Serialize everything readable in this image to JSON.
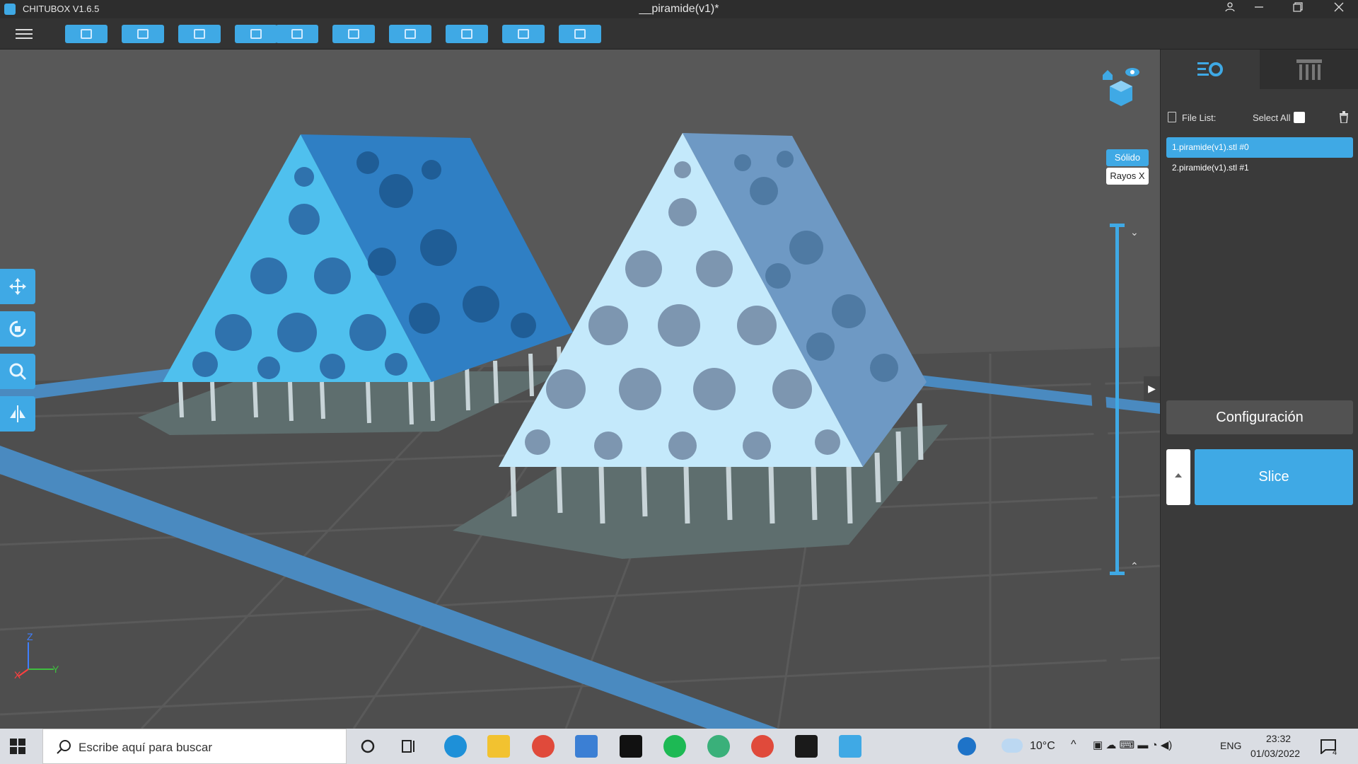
{
  "window": {
    "app_name": "CHITUBOX V1.6.5",
    "document_title": "__piramide(v1)*"
  },
  "colors": {
    "accent": "#3fa9e5",
    "viewport_bg": "#585858",
    "panel_bg": "#3a3a3a",
    "model_primary": "#4aa9e8",
    "model_highlight": "#9ad8f5",
    "support": "#c8d4d8",
    "raft": "#5e6e6e",
    "plate_border": "#4a8ac0"
  },
  "toolbar": {
    "buttons": [
      {
        "name": "open-file-button",
        "icon": "folder-icon"
      },
      {
        "name": "save-button",
        "icon": "floppy-icon"
      },
      {
        "name": "screenshot-button",
        "icon": "frame-icon"
      },
      {
        "name": "undo-button",
        "icon": "undo-icon"
      },
      {
        "name": "redo-button",
        "icon": "redo-icon"
      },
      {
        "name": "document-button",
        "icon": "document-icon"
      },
      {
        "name": "arrange-button",
        "icon": "layout-icon"
      },
      {
        "name": "hollow-button",
        "icon": "bottle-icon"
      },
      {
        "name": "print-preview-button",
        "icon": "square-icon"
      },
      {
        "name": "export-button",
        "icon": "package-icon"
      }
    ]
  },
  "view": {
    "mode_solid": "Sólido",
    "mode_xray": "Rayos X"
  },
  "axes": {
    "x": "X",
    "y": "Y",
    "z": "Z"
  },
  "panel": {
    "file_list_label": "File List:",
    "select_all_label": "Select All",
    "files": [
      "1.piramide(v1).stl #0",
      "2.piramide(v1).stl #1"
    ],
    "config_button": "Configuración",
    "slice_button": "Slice"
  },
  "taskbar": {
    "search_placeholder": "Escribe aquí para buscar",
    "weather": "10°C",
    "language": "ENG",
    "time": "23:32",
    "date": "01/03/2022",
    "notification_count": "4"
  }
}
